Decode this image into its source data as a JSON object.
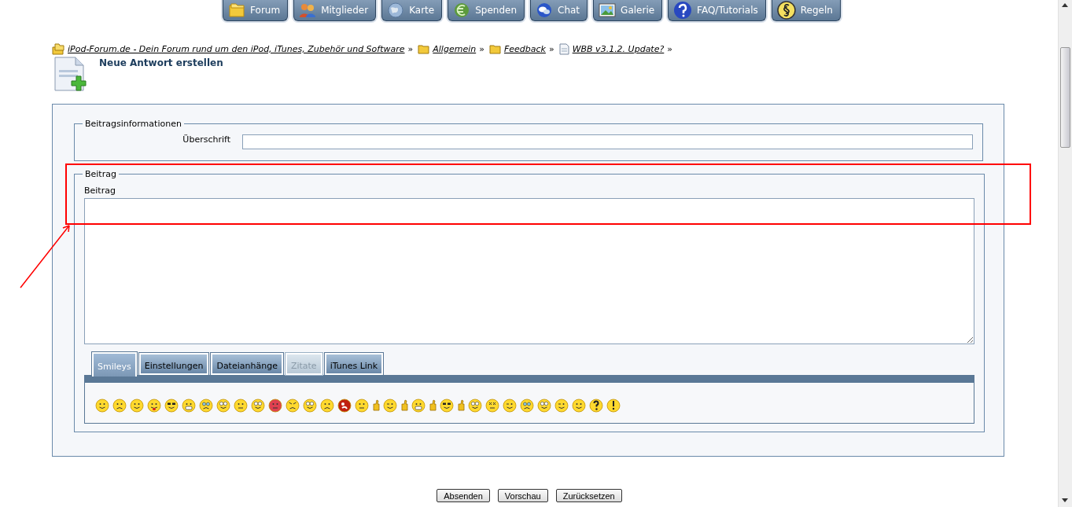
{
  "nav": [
    {
      "label": "Forum"
    },
    {
      "label": "Mitglieder"
    },
    {
      "label": "Karte"
    },
    {
      "label": "Spenden"
    },
    {
      "label": "Chat"
    },
    {
      "label": "Galerie"
    },
    {
      "label": "FAQ/Tutorials"
    },
    {
      "label": "Regeln"
    }
  ],
  "breadcrumb": [
    {
      "label": "iPod-Forum.de - Dein Forum rund um den iPod, iTunes, Zubehör und Software",
      "separator": "»"
    },
    {
      "label": "Allgemein",
      "separator": "»"
    },
    {
      "label": "Feedback",
      "separator": "»"
    },
    {
      "label": "WBB v3.1.2. Update?",
      "separator": "»"
    }
  ],
  "page_title": "Neue Antwort erstellen",
  "post_info": {
    "legend": "Beitragsinformationen",
    "subject_label": "Überschrift"
  },
  "post": {
    "legend": "Beitrag",
    "body_label": "Beitrag"
  },
  "tabs": [
    {
      "label": "Smileys",
      "selected": true,
      "disabled": false
    },
    {
      "label": "Einstellungen",
      "selected": false,
      "disabled": false
    },
    {
      "label": "Dateianhänge",
      "selected": false,
      "disabled": false
    },
    {
      "label": "Zitate",
      "selected": false,
      "disabled": true
    },
    {
      "label": "iTunes Link",
      "selected": false,
      "disabled": false
    }
  ],
  "buttons": [
    {
      "label": "Absenden"
    },
    {
      "label": "Vorschau"
    },
    {
      "label": "Zurücksetzen"
    }
  ]
}
